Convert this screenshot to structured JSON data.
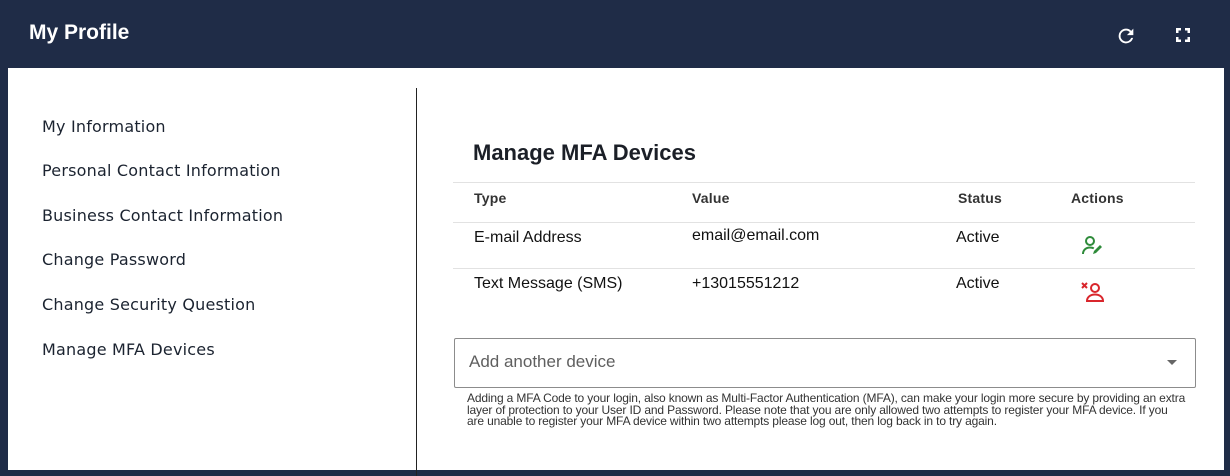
{
  "header": {
    "title": "My Profile",
    "refresh_icon": "refresh-icon",
    "fullscreen_icon": "fullscreen-icon"
  },
  "sidebar": {
    "items": [
      {
        "label": "My Information"
      },
      {
        "label": "Personal Contact Information"
      },
      {
        "label": "Business Contact Information"
      },
      {
        "label": "Change Password"
      },
      {
        "label": "Change Security Question"
      },
      {
        "label": "Manage MFA Devices"
      }
    ]
  },
  "main": {
    "title": "Manage MFA Devices",
    "table": {
      "columns": [
        "Type",
        "Value",
        "Status",
        "Actions"
      ],
      "rows": [
        {
          "type": "E-mail Address",
          "value": "email@email.com",
          "status": "Active",
          "action_icon": "edit-user-icon"
        },
        {
          "type": "Text Message (SMS)",
          "value": "+13015551212",
          "status": "Active",
          "action_icon": "remove-user-icon"
        }
      ]
    },
    "add_device": {
      "placeholder": "Add another device"
    },
    "help_text": "Adding a MFA Code to your login, also known as Multi-Factor Authentication (MFA), can make your login more secure by providing an extra layer of protection to your User ID and Password. Please note that you are only allowed two attempts to register your MFA device. If you are unable to register your MFA device within two attempts please log out, then log back in to try again."
  },
  "colors": {
    "header_bg": "#1f2c47",
    "edit_icon": "#2e8b3a",
    "remove_icon": "#d9262c"
  }
}
